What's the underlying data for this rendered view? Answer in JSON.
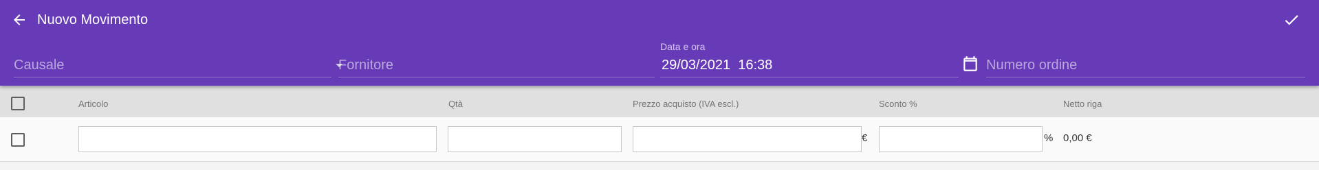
{
  "header": {
    "title": "Nuovo Movimento",
    "back_icon": "arrow-left-icon",
    "confirm_icon": "check-icon",
    "background_color": "#673ab7"
  },
  "form": {
    "causale": {
      "placeholder": "Causale",
      "value": ""
    },
    "fornitore": {
      "placeholder": "Fornitore",
      "value": ""
    },
    "data_ora": {
      "label": "Data e ora",
      "value": "29/03/2021  16:38"
    },
    "numero_ordine": {
      "placeholder": "Numero ordine",
      "value": ""
    },
    "calendar_icon": "calendar-icon"
  },
  "table": {
    "columns": [
      "Articolo",
      "Qtà",
      "Prezzo acquisto (IVA escl.)",
      "Sconto %",
      "Netto riga"
    ],
    "rows": [
      {
        "articolo": "",
        "qta": "",
        "prezzo": "",
        "prezzo_suffix": "€",
        "sconto": "",
        "sconto_suffix": "%",
        "netto": "0,00 €",
        "checked": false
      }
    ],
    "header_checked": false
  }
}
